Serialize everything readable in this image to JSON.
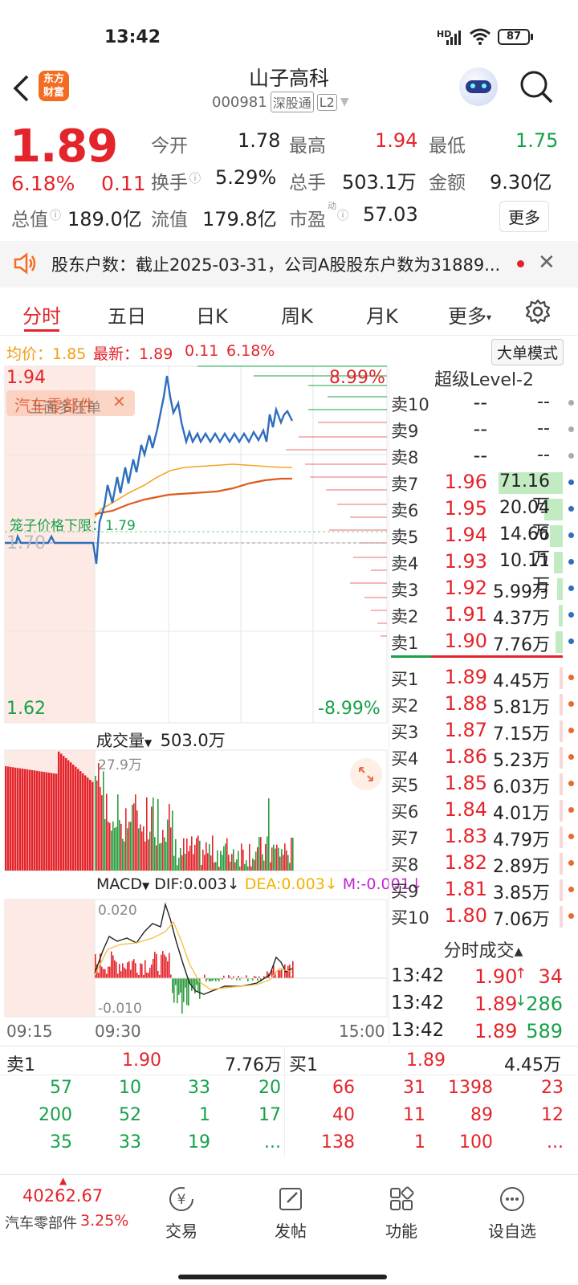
{
  "status": {
    "time": "13:42",
    "battery": "87",
    "network": "HD"
  },
  "header": {
    "title": "山子高科",
    "code": "000981",
    "badge1": "深股通",
    "badge2": "L2",
    "logo_text_1": "东方",
    "logo_text_2": "财富"
  },
  "quote": {
    "price": "1.89",
    "change_pct": "6.18%",
    "change_amt": "0.11",
    "open_label": "今开",
    "open": "1.78",
    "high_label": "最高",
    "high": "1.94",
    "low_label": "最低",
    "low": "1.75",
    "turnover_label": "换手",
    "turnover": "5.29%",
    "volume_label": "总手",
    "volume": "503.1万",
    "amount_label": "金额",
    "amount": "9.30亿",
    "mktcap_label": "总值",
    "mktcap": "189.0亿",
    "float_label": "流值",
    "float": "179.8亿",
    "pe_label": "市盈",
    "pe_sup": "动",
    "pe": "57.03",
    "more": "更多"
  },
  "notice": {
    "text": "股东户数：截止2025-03-31，公司A股股东户数为31889..."
  },
  "tabs": [
    "分时",
    "五日",
    "日K",
    "周K",
    "月K",
    "更多"
  ],
  "chart_info": {
    "avg_label": "均价：1.85",
    "last_label": "最新：1.89",
    "chg": "0.11",
    "pct": "6.18%",
    "mode_button": "大单模式"
  },
  "chart_labels": {
    "max_price": "1.94",
    "max_pct": "8.99%",
    "min_price": "1.62",
    "min_pct": "-8.99%",
    "ref_price": "1.70",
    "limit_label": "笼子价格下限：1.79",
    "sector_tag": "汽车零部件",
    "overlay_text": "上面多压单",
    "vol_label": "成交量",
    "vol_total": "503.0万",
    "vol_max": "27.9万",
    "macd_label": "MACD",
    "dif": "DIF:0.003",
    "dea": "DEA:0.003",
    "m": "M:-0.001",
    "macd_max": "0.020",
    "macd_min": "-0.010",
    "t_start": "09:15",
    "t_open": "09:30",
    "t_end": "15:00"
  },
  "orderbook": {
    "title": "超级Level-2",
    "asks": [
      {
        "label": "卖10",
        "price": "--",
        "vol": "--"
      },
      {
        "label": "卖9",
        "price": "--",
        "vol": "--"
      },
      {
        "label": "卖8",
        "price": "--",
        "vol": "--"
      },
      {
        "label": "卖7",
        "price": "1.96",
        "vol": "71.16万"
      },
      {
        "label": "卖6",
        "price": "1.95",
        "vol": "20.04万"
      },
      {
        "label": "卖5",
        "price": "1.94",
        "vol": "14.66万"
      },
      {
        "label": "卖4",
        "price": "1.93",
        "vol": "10.11万"
      },
      {
        "label": "卖3",
        "price": "1.92",
        "vol": "5.99万"
      },
      {
        "label": "卖2",
        "price": "1.91",
        "vol": "4.37万"
      },
      {
        "label": "卖1",
        "price": "1.90",
        "vol": "7.76万"
      }
    ],
    "bids": [
      {
        "label": "买1",
        "price": "1.89",
        "vol": "4.45万"
      },
      {
        "label": "买2",
        "price": "1.88",
        "vol": "5.81万"
      },
      {
        "label": "买3",
        "price": "1.87",
        "vol": "7.15万"
      },
      {
        "label": "买4",
        "price": "1.86",
        "vol": "5.23万"
      },
      {
        "label": "买5",
        "price": "1.85",
        "vol": "6.03万"
      },
      {
        "label": "买6",
        "price": "1.84",
        "vol": "4.01万"
      },
      {
        "label": "买7",
        "price": "1.83",
        "vol": "4.79万"
      },
      {
        "label": "买8",
        "price": "1.82",
        "vol": "2.89万"
      },
      {
        "label": "买9",
        "price": "1.81",
        "vol": "3.85万"
      },
      {
        "label": "买10",
        "price": "1.80",
        "vol": "7.06万"
      }
    ],
    "ticks_title": "分时成交",
    "ticks": [
      {
        "time": "13:42",
        "price": "1.90",
        "arrow": "↑",
        "vol": "34"
      },
      {
        "time": "13:42",
        "price": "1.89",
        "arrow": "↓",
        "vol": "286"
      },
      {
        "time": "13:42",
        "price": "1.89",
        "arrow": "",
        "vol": "589"
      }
    ]
  },
  "queue": {
    "ask_label": "卖1",
    "ask_price": "1.90",
    "ask_vol": "7.76万",
    "bid_label": "买1",
    "bid_price": "1.89",
    "bid_vol": "4.45万",
    "ask_rows": [
      [
        "57",
        "10",
        "33",
        "20"
      ],
      [
        "200",
        "52",
        "1",
        "17"
      ],
      [
        "35",
        "33",
        "19",
        "..."
      ]
    ],
    "bid_rows": [
      [
        "66",
        "31",
        "1398",
        "23"
      ],
      [
        "40",
        "11",
        "89",
        "12"
      ],
      [
        "138",
        "1",
        "100",
        "..."
      ]
    ]
  },
  "bottom": {
    "index_value": "40262.67",
    "index_name": "汽车零部件",
    "index_pct": "3.25%",
    "nav": [
      "交易",
      "发帖",
      "功能",
      "设自选"
    ]
  }
}
